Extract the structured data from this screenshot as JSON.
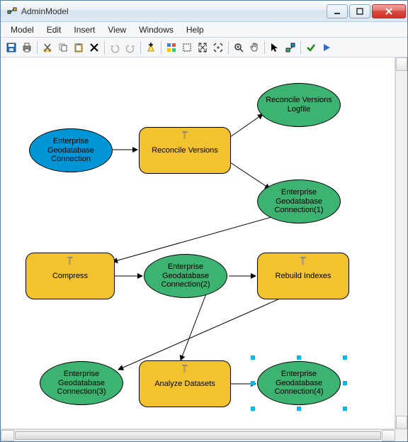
{
  "window": {
    "title": "AdminModel"
  },
  "menu": {
    "model": "Model",
    "edit": "Edit",
    "insert": "Insert",
    "view": "View",
    "windows": "Windows",
    "help": "Help"
  },
  "nodes": {
    "input": "Enterprise Geodatabase Connection",
    "reconcile": "Reconcile Versions",
    "logfile": "Reconcile Versions Logfile",
    "conn1": "Enterprise Geodatabase Connection(1)",
    "compress": "Compress",
    "conn2": "Enterprise Geodatabase Connection(2)",
    "rebuild": "Rebuild Indexes",
    "conn3": "Enterprise Geodatabase Connection(3)",
    "analyze": "Analyze Datasets",
    "conn4": "Enterprise Geodatabase Connection(4)"
  },
  "chart_data": {
    "type": "diagram",
    "title": "AdminModel",
    "nodes": [
      {
        "id": "input",
        "label": "Enterprise Geodatabase Connection",
        "shape": "ellipse",
        "role": "input",
        "color": "#0096d6"
      },
      {
        "id": "reconcile",
        "label": "Reconcile Versions",
        "shape": "rect",
        "role": "tool",
        "color": "#f2c22f"
      },
      {
        "id": "logfile",
        "label": "Reconcile Versions Logfile",
        "shape": "ellipse",
        "role": "output",
        "color": "#3cb371"
      },
      {
        "id": "conn1",
        "label": "Enterprise Geodatabase Connection(1)",
        "shape": "ellipse",
        "role": "output",
        "color": "#3cb371"
      },
      {
        "id": "compress",
        "label": "Compress",
        "shape": "rect",
        "role": "tool",
        "color": "#f2c22f"
      },
      {
        "id": "conn2",
        "label": "Enterprise Geodatabase Connection(2)",
        "shape": "ellipse",
        "role": "output",
        "color": "#3cb371"
      },
      {
        "id": "rebuild",
        "label": "Rebuild Indexes",
        "shape": "rect",
        "role": "tool",
        "color": "#f2c22f"
      },
      {
        "id": "conn3",
        "label": "Enterprise Geodatabase Connection(3)",
        "shape": "ellipse",
        "role": "output",
        "color": "#3cb371"
      },
      {
        "id": "analyze",
        "label": "Analyze Datasets",
        "shape": "rect",
        "role": "tool",
        "color": "#f2c22f"
      },
      {
        "id": "conn4",
        "label": "Enterprise Geodatabase Connection(4)",
        "shape": "ellipse",
        "role": "output",
        "color": "#3cb371",
        "selected": true
      }
    ],
    "edges": [
      {
        "from": "input",
        "to": "reconcile"
      },
      {
        "from": "reconcile",
        "to": "logfile"
      },
      {
        "from": "reconcile",
        "to": "conn1"
      },
      {
        "from": "conn1",
        "to": "compress"
      },
      {
        "from": "compress",
        "to": "conn2"
      },
      {
        "from": "conn2",
        "to": "rebuild"
      },
      {
        "from": "conn2",
        "to": "analyze"
      },
      {
        "from": "rebuild",
        "to": "conn3"
      },
      {
        "from": "analyze",
        "to": "conn4"
      }
    ]
  }
}
